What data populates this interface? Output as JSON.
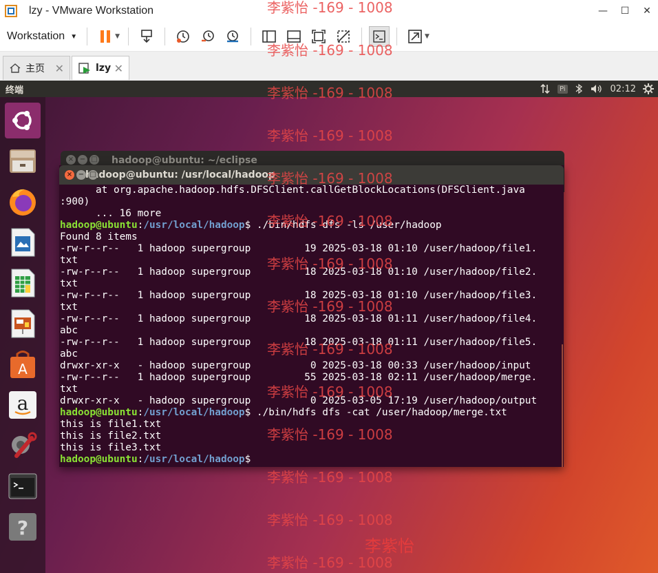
{
  "window": {
    "title": "lzy - VMware Workstation",
    "min": "—",
    "max": "☐",
    "close": "✕"
  },
  "toolbar": {
    "menu_label": "Workstation"
  },
  "tabs": [
    {
      "label": "主页"
    },
    {
      "label": "lzy"
    }
  ],
  "topbar": {
    "app_name": "终端",
    "indicator": "Pi",
    "time": "02:12"
  },
  "launcher": [
    "ubuntu-logo",
    "files",
    "firefox",
    "libreoffice-writer",
    "libreoffice-calc",
    "libreoffice-impress",
    "software-center",
    "amazon",
    "system-settings",
    "terminal",
    "help"
  ],
  "terminal_back": {
    "title": "hadoop@ubuntu: ~/eclipse"
  },
  "terminal": {
    "title": "hadoop@ubuntu: /usr/local/hadoop",
    "prompt_user": "hadoop@ubuntu",
    "prompt_path": "/usr/local/hadoop",
    "lines": [
      {
        "kind": "out",
        "text": "      at org.apache.hadoop.hdfs.DFSClient.callGetBlockLocations(DFSClient.java"
      },
      {
        "kind": "out",
        "text": ":900)"
      },
      {
        "kind": "out",
        "text": "      ... 16 more"
      },
      {
        "kind": "cmd",
        "text": "$ ./bin/hdfs dfs -ls /user/hadoop"
      },
      {
        "kind": "out",
        "text": "Found 8 items"
      },
      {
        "kind": "out",
        "text": "-rw-r--r--   1 hadoop supergroup         19 2025-03-18 01:10 /user/hadoop/file1."
      },
      {
        "kind": "out",
        "text": "txt"
      },
      {
        "kind": "out",
        "text": "-rw-r--r--   1 hadoop supergroup         18 2025-03-18 01:10 /user/hadoop/file2."
      },
      {
        "kind": "out",
        "text": "txt"
      },
      {
        "kind": "out",
        "text": "-rw-r--r--   1 hadoop supergroup         18 2025-03-18 01:10 /user/hadoop/file3."
      },
      {
        "kind": "out",
        "text": "txt"
      },
      {
        "kind": "out",
        "text": "-rw-r--r--   1 hadoop supergroup         18 2025-03-18 01:11 /user/hadoop/file4."
      },
      {
        "kind": "out",
        "text": "abc"
      },
      {
        "kind": "out",
        "text": "-rw-r--r--   1 hadoop supergroup         18 2025-03-18 01:11 /user/hadoop/file5."
      },
      {
        "kind": "out",
        "text": "abc"
      },
      {
        "kind": "out",
        "text": "drwxr-xr-x   - hadoop supergroup          0 2025-03-18 00:33 /user/hadoop/input"
      },
      {
        "kind": "out",
        "text": "-rw-r--r--   1 hadoop supergroup         55 2025-03-18 02:11 /user/hadoop/merge."
      },
      {
        "kind": "out",
        "text": "txt"
      },
      {
        "kind": "out",
        "text": "drwxr-xr-x   - hadoop supergroup          0 2025-03-05 17:19 /user/hadoop/output"
      },
      {
        "kind": "cmd",
        "text": "$ ./bin/hdfs dfs -cat /user/hadoop/merge.txt"
      },
      {
        "kind": "out",
        "text": "this is file1.txt"
      },
      {
        "kind": "out",
        "text": "this is file2.txt"
      },
      {
        "kind": "out",
        "text": "this is file3.txt"
      },
      {
        "kind": "cmd",
        "text": "$ "
      }
    ]
  },
  "watermark": {
    "text": "李紫怡 -169 - 1008",
    "signature": "李紫怡"
  }
}
